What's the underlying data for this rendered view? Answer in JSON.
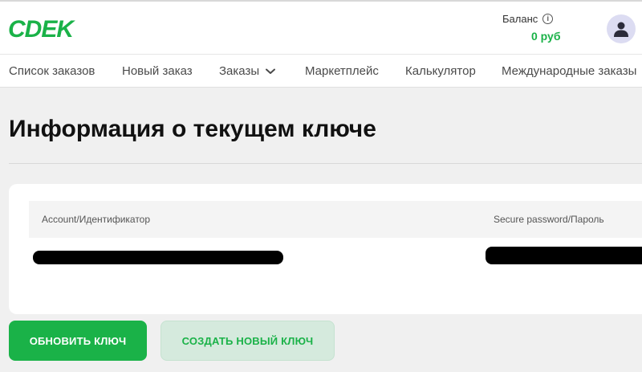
{
  "header": {
    "logo_text": "CDEK",
    "balance_label": "Баланс",
    "balance_value": "0 руб"
  },
  "nav": {
    "items": [
      {
        "label": "Список заказов"
      },
      {
        "label": "Новый заказ"
      },
      {
        "label": "Заказы"
      },
      {
        "label": "Маркетплейс"
      },
      {
        "label": "Калькулятор"
      },
      {
        "label": "Международные заказы"
      }
    ]
  },
  "main": {
    "title": "Информация о текущем ключе",
    "table": {
      "columns": [
        "Account/Идентификатор",
        "Secure password/Пароль"
      ]
    }
  },
  "actions": {
    "refresh_label": "Обновить ключ",
    "create_label": "Создать новый ключ"
  },
  "colors": {
    "brand_green": "#1ab248",
    "secondary_button_bg": "#d5eadd",
    "avatar_bg": "#dcdcf2"
  }
}
